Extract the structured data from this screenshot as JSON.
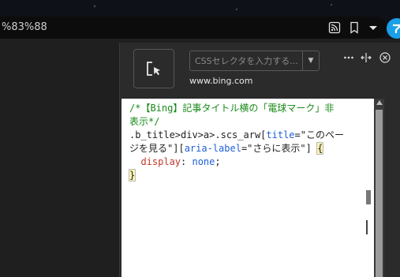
{
  "browser": {
    "url_text": "%83%88",
    "icons": [
      "rss-icon",
      "bookmark-icon",
      "dropdown-arrow-icon",
      "profile-icon"
    ]
  },
  "panel": {
    "selector_placeholder": "CSSセレクタを入力する...",
    "site": "www.bing.com",
    "header_icons": [
      "more-icon",
      "dock-icon",
      "close-icon"
    ]
  },
  "code": {
    "comment_line1": "/*【Bing】記事タイトル横の「電球マーク」非",
    "comment_line2": "表示*/",
    "selector_line1_a": ".b_title>div>a>.scs_arw[",
    "attr1": "title",
    "eq1": "=\"",
    "str1a": "このペー",
    "selector_line2_a": "ジを見る\"][",
    "attr2": "aria-label",
    "eq2": "=\"",
    "str2": "さらに表示",
    "close2": "\"] ",
    "open_brace": "{",
    "prop": "display",
    "colon": ": ",
    "val": "none",
    "semi": ";",
    "close_brace": "}"
  }
}
